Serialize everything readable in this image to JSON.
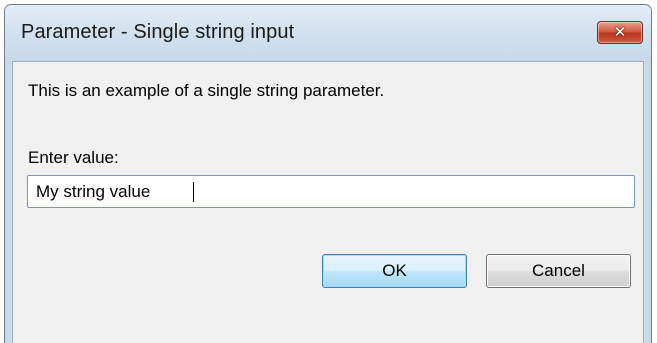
{
  "window": {
    "title": "Parameter - Single string input"
  },
  "dialog": {
    "description": "This is an example of a single string parameter.",
    "field_label": "Enter value:",
    "input_value": "My string value"
  },
  "buttons": {
    "ok_label": "OK",
    "cancel_label": "Cancel"
  },
  "icons": {
    "close": "close-icon"
  },
  "colors": {
    "titlebar": "#c8daea",
    "close_button": "#c8452d",
    "client_background": "#f0f0f0",
    "default_button_border": "#3c7fb1"
  }
}
